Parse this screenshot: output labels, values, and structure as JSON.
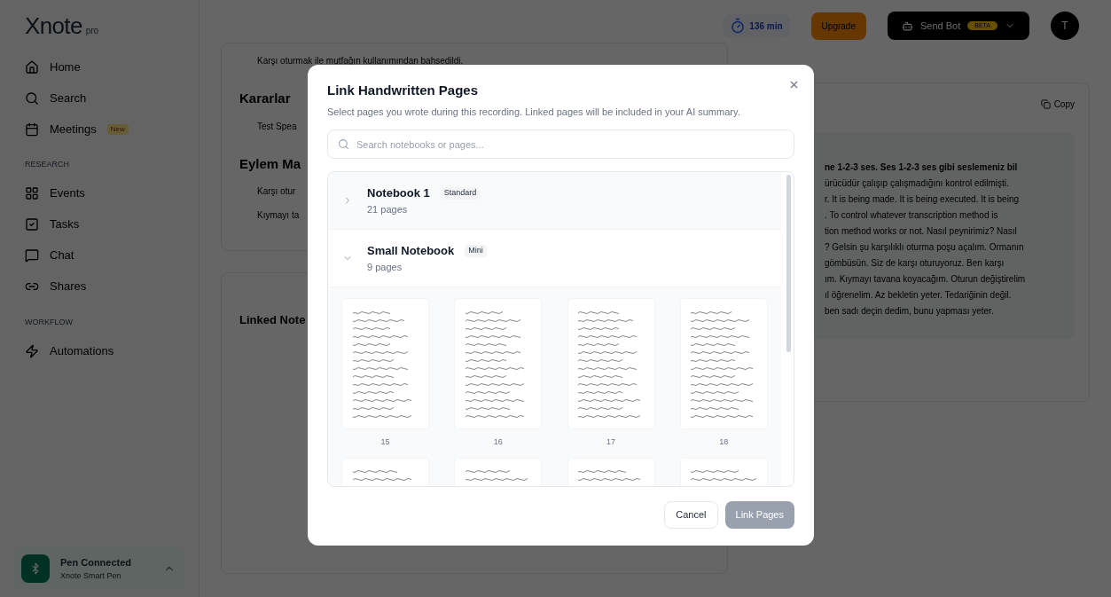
{
  "sidebar": {
    "logo": "Xnote",
    "logo_suffix": "pro",
    "sections": [
      {
        "items": [
          {
            "label": "Home"
          },
          {
            "label": "Search"
          },
          {
            "label": "Meetings",
            "badge": "New"
          }
        ]
      },
      {
        "label": "RESEARCH",
        "items": [
          {
            "label": "Events"
          },
          {
            "label": "Tasks"
          },
          {
            "label": "Chat"
          },
          {
            "label": "Shares"
          }
        ]
      },
      {
        "label": "WORKFLOW",
        "items": [
          {
            "label": "Automations"
          }
        ]
      }
    ],
    "pen": {
      "title": "Pen Connected",
      "subtitle": "Xnote Smart Pen"
    }
  },
  "topbar": {
    "minutes": "136 min",
    "upgrade": "Upgrade",
    "send_bot": "Send Bot",
    "send_bot_badge": "BETA",
    "avatar": "T"
  },
  "summary": {
    "top_bullet": "Karşı oturmak ile mutfağın kullanımından bahsedildi.",
    "sections": [
      {
        "heading": "Kararlar",
        "items": [
          "Test Spea"
        ]
      },
      {
        "heading": "Eylem Ma",
        "items": [
          "Karşı otur",
          "Kıymayı ta"
        ]
      }
    ],
    "linked_heading": "Linked Note"
  },
  "transcript": {
    "copy": "Copy",
    "lines": [
      {
        "text": "ne 1-2-3 ses. Ses 1-2-3 ses gibi seslemeniz bil",
        "bold": true
      },
      {
        "text": "ürücüdür çalışıp çalışmadığını kontrol edilmişti.",
        "bold": false
      },
      {
        "text": "r. It is being made. It is being executed. It is being",
        "bold": false
      },
      {
        "text": ". To control whatever transcription method is",
        "bold": false
      },
      {
        "text": "tion method works or not. Nasıl peynirimiz? Nasıl",
        "bold": false
      },
      {
        "text": "? Gelsin şu karşılıklı oturma poşu açalım. Ormanın",
        "bold": false
      },
      {
        "text": "gömbüsün. Siz de karşı oturuyoruz. Ben karşı",
        "bold": false
      },
      {
        "text": "ım. Kıymayı tavana koyacağım. Oturun değiştirelim",
        "bold": false
      },
      {
        "text": "ıl öğrenelim. Az bekletin yeter. Tedariğinin değil.",
        "bold": false
      },
      {
        "text": "ben sadı deçin dedim, bunu yapması yeter.",
        "bold": false
      }
    ]
  },
  "dialog": {
    "title": "Link Handwritten Pages",
    "subtitle": "Select pages you wrote during this recording. Linked pages will be included in your AI summary.",
    "search": {
      "placeholder": "Search notebooks or pages..."
    },
    "notebooks": [
      {
        "name": "Notebook 1",
        "tag": "Standard",
        "pages": "21 pages",
        "expanded": false
      },
      {
        "name": "Small Notebook",
        "tag": "Mini",
        "pages": "9 pages",
        "expanded": true,
        "thumbnails": [
          {
            "kind": "numbered",
            "page": "15"
          },
          {
            "kind": "numbered",
            "page": "16"
          },
          {
            "kind": "numbered",
            "page": "17"
          },
          {
            "kind": "numbered",
            "page": "18"
          },
          {
            "kind": "cut"
          },
          {
            "kind": "cut"
          },
          {
            "kind": "cut"
          },
          {
            "kind": "cut"
          }
        ]
      }
    ],
    "cancel": "Cancel",
    "confirm": "Link Pages",
    "confirm_disabled": true
  }
}
